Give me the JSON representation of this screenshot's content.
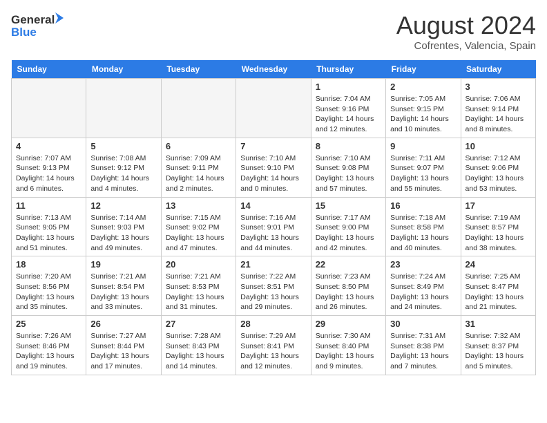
{
  "header": {
    "logo_line1": "General",
    "logo_line2": "Blue",
    "month": "August 2024",
    "location": "Cofrentes, Valencia, Spain"
  },
  "weekdays": [
    "Sunday",
    "Monday",
    "Tuesday",
    "Wednesday",
    "Thursday",
    "Friday",
    "Saturday"
  ],
  "weeks": [
    [
      {
        "day": "",
        "info": ""
      },
      {
        "day": "",
        "info": ""
      },
      {
        "day": "",
        "info": ""
      },
      {
        "day": "",
        "info": ""
      },
      {
        "day": "1",
        "info": "Sunrise: 7:04 AM\nSunset: 9:16 PM\nDaylight: 14 hours and 12 minutes."
      },
      {
        "day": "2",
        "info": "Sunrise: 7:05 AM\nSunset: 9:15 PM\nDaylight: 14 hours and 10 minutes."
      },
      {
        "day": "3",
        "info": "Sunrise: 7:06 AM\nSunset: 9:14 PM\nDaylight: 14 hours and 8 minutes."
      }
    ],
    [
      {
        "day": "4",
        "info": "Sunrise: 7:07 AM\nSunset: 9:13 PM\nDaylight: 14 hours and 6 minutes."
      },
      {
        "day": "5",
        "info": "Sunrise: 7:08 AM\nSunset: 9:12 PM\nDaylight: 14 hours and 4 minutes."
      },
      {
        "day": "6",
        "info": "Sunrise: 7:09 AM\nSunset: 9:11 PM\nDaylight: 14 hours and 2 minutes."
      },
      {
        "day": "7",
        "info": "Sunrise: 7:10 AM\nSunset: 9:10 PM\nDaylight: 14 hours and 0 minutes."
      },
      {
        "day": "8",
        "info": "Sunrise: 7:10 AM\nSunset: 9:08 PM\nDaylight: 13 hours and 57 minutes."
      },
      {
        "day": "9",
        "info": "Sunrise: 7:11 AM\nSunset: 9:07 PM\nDaylight: 13 hours and 55 minutes."
      },
      {
        "day": "10",
        "info": "Sunrise: 7:12 AM\nSunset: 9:06 PM\nDaylight: 13 hours and 53 minutes."
      }
    ],
    [
      {
        "day": "11",
        "info": "Sunrise: 7:13 AM\nSunset: 9:05 PM\nDaylight: 13 hours and 51 minutes."
      },
      {
        "day": "12",
        "info": "Sunrise: 7:14 AM\nSunset: 9:03 PM\nDaylight: 13 hours and 49 minutes."
      },
      {
        "day": "13",
        "info": "Sunrise: 7:15 AM\nSunset: 9:02 PM\nDaylight: 13 hours and 47 minutes."
      },
      {
        "day": "14",
        "info": "Sunrise: 7:16 AM\nSunset: 9:01 PM\nDaylight: 13 hours and 44 minutes."
      },
      {
        "day": "15",
        "info": "Sunrise: 7:17 AM\nSunset: 9:00 PM\nDaylight: 13 hours and 42 minutes."
      },
      {
        "day": "16",
        "info": "Sunrise: 7:18 AM\nSunset: 8:58 PM\nDaylight: 13 hours and 40 minutes."
      },
      {
        "day": "17",
        "info": "Sunrise: 7:19 AM\nSunset: 8:57 PM\nDaylight: 13 hours and 38 minutes."
      }
    ],
    [
      {
        "day": "18",
        "info": "Sunrise: 7:20 AM\nSunset: 8:56 PM\nDaylight: 13 hours and 35 minutes."
      },
      {
        "day": "19",
        "info": "Sunrise: 7:21 AM\nSunset: 8:54 PM\nDaylight: 13 hours and 33 minutes."
      },
      {
        "day": "20",
        "info": "Sunrise: 7:21 AM\nSunset: 8:53 PM\nDaylight: 13 hours and 31 minutes."
      },
      {
        "day": "21",
        "info": "Sunrise: 7:22 AM\nSunset: 8:51 PM\nDaylight: 13 hours and 29 minutes."
      },
      {
        "day": "22",
        "info": "Sunrise: 7:23 AM\nSunset: 8:50 PM\nDaylight: 13 hours and 26 minutes."
      },
      {
        "day": "23",
        "info": "Sunrise: 7:24 AM\nSunset: 8:49 PM\nDaylight: 13 hours and 24 minutes."
      },
      {
        "day": "24",
        "info": "Sunrise: 7:25 AM\nSunset: 8:47 PM\nDaylight: 13 hours and 21 minutes."
      }
    ],
    [
      {
        "day": "25",
        "info": "Sunrise: 7:26 AM\nSunset: 8:46 PM\nDaylight: 13 hours and 19 minutes."
      },
      {
        "day": "26",
        "info": "Sunrise: 7:27 AM\nSunset: 8:44 PM\nDaylight: 13 hours and 17 minutes."
      },
      {
        "day": "27",
        "info": "Sunrise: 7:28 AM\nSunset: 8:43 PM\nDaylight: 13 hours and 14 minutes."
      },
      {
        "day": "28",
        "info": "Sunrise: 7:29 AM\nSunset: 8:41 PM\nDaylight: 13 hours and 12 minutes."
      },
      {
        "day": "29",
        "info": "Sunrise: 7:30 AM\nSunset: 8:40 PM\nDaylight: 13 hours and 9 minutes."
      },
      {
        "day": "30",
        "info": "Sunrise: 7:31 AM\nSunset: 8:38 PM\nDaylight: 13 hours and 7 minutes."
      },
      {
        "day": "31",
        "info": "Sunrise: 7:32 AM\nSunset: 8:37 PM\nDaylight: 13 hours and 5 minutes."
      }
    ]
  ]
}
